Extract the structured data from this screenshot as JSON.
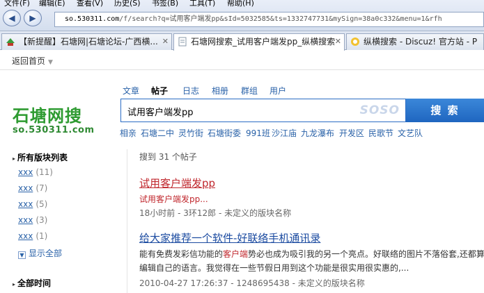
{
  "browser": {
    "menu": [
      "文件(F)",
      "编辑(E)",
      "查看(V)",
      "历史(S)",
      "书签(B)",
      "工具(T)",
      "帮助(H)"
    ],
    "url_host": "so.530311.com",
    "url_path": "/f/search?q=试用客户端发pp&sId=5032585&ts=1332747731&mySign=38a0c332&menu=1&rfh"
  },
  "tabs": [
    {
      "label": "【新提醒】石塘网|石塘论坛-广西横...",
      "active": false
    },
    {
      "label": "石塘网搜索_试用客户端发pp_纵横搜索",
      "active": true
    },
    {
      "label": "纵横搜索 - Discuz! 官方站 - P",
      "active": false
    }
  ],
  "back_label": "返回首页",
  "logo": {
    "cn": "石塘网搜",
    "en": "so.530311.com"
  },
  "search_tabs": [
    "文章",
    "帖子",
    "日志",
    "相册",
    "群组",
    "用户"
  ],
  "search_tab_active": "帖子",
  "search": {
    "value": "试用客户端发pp",
    "watermark": "SOSO",
    "button": "搜 索"
  },
  "hot_words": [
    "相亲",
    "石塘二中",
    "灵竹街",
    "石塘街委",
    "991班",
    "沙江庙",
    "九龙瀑布",
    "开发区",
    "民歌节",
    "文艺队"
  ],
  "sidebar": {
    "heading_forums": "所有版块列表",
    "forums": [
      {
        "name": "xxx",
        "count": "(11)"
      },
      {
        "name": "xxx",
        "count": "(7)"
      },
      {
        "name": "xxx",
        "count": "(5)"
      },
      {
        "name": "xxx",
        "count": "(3)"
      },
      {
        "name": "xxx",
        "count": "(1)"
      }
    ],
    "show_all": "显示全部",
    "heading_time": "全部时间"
  },
  "results": {
    "count_text": "搜到 31 个帖子",
    "items": [
      {
        "title": "试用客户端发pp",
        "snippet_hl": "试用客户端发pp...",
        "meta": "18小时前 - 3环12郎 - 未定义的版块名称"
      },
      {
        "title": "给大家推荐一个软件-好联络手机通讯录",
        "snippet1_a": "能有免费发彩信功能的",
        "snippet1_hl": "客户端",
        "snippet1_b": "势必也成为吸引我的另一个亮点。好联络的图片不落俗套,还都算",
        "snippet2": "编辑自己的语言。我觉得在一些节假日用到这个功能是很实用很实惠的,...",
        "meta": "2010-04-27 17:26:37 - 1248695438 - 未定义的版块名称"
      }
    ]
  },
  "colors": {
    "accent": "#1f66c0",
    "logo_green": "#2e9b31",
    "highlight": "#c0272d",
    "link": "#2a62a8"
  }
}
